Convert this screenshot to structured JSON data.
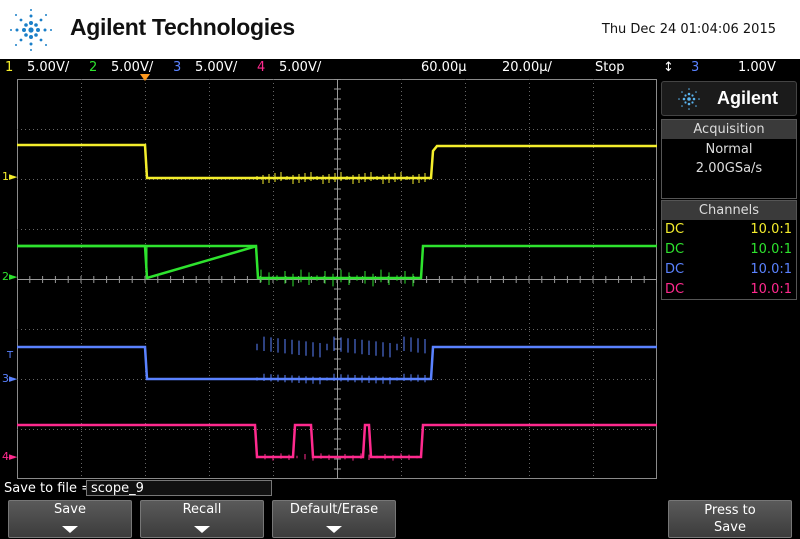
{
  "header": {
    "brand": "Agilent Technologies",
    "datetime": "Thu Dec 24 01:04:06 2015"
  },
  "status_bar": {
    "channels": [
      {
        "num": "1",
        "scale": "5.00V/",
        "color": "#f4ee2c"
      },
      {
        "num": "2",
        "scale": "5.00V/",
        "color": "#2ee32e"
      },
      {
        "num": "3",
        "scale": "5.00V/",
        "color": "#5a82ff"
      },
      {
        "num": "4",
        "scale": "5.00V/",
        "color": "#ff2a8e"
      }
    ],
    "h_delay": "60.00µ",
    "h_scale": "20.00µ/",
    "run_state": "Stop",
    "trigger_symbol": "↕",
    "trigger_source": "3",
    "trigger_level": "1.00V"
  },
  "right_panel": {
    "logo": "Agilent",
    "acquisition": {
      "title": "Acquisition",
      "mode": "Normal",
      "rate": "2.00GSa/s"
    },
    "channels": {
      "title": "Channels",
      "rows": [
        {
          "coupling": "DC",
          "probe": "10.0:1",
          "color": "#f4ee2c"
        },
        {
          "coupling": "DC",
          "probe": "10.0:1",
          "color": "#2ee32e"
        },
        {
          "coupling": "DC",
          "probe": "10.0:1",
          "color": "#5a82ff"
        },
        {
          "coupling": "DC",
          "probe": "10.0:1",
          "color": "#ff2a8e"
        }
      ]
    }
  },
  "grid_markers": {
    "ch1": "1",
    "ch2": "2",
    "ch3": "3",
    "ch4": "4",
    "trigger": "T"
  },
  "save": {
    "label": "Save to file =",
    "filename": "scope_9"
  },
  "softkeys": [
    {
      "label": "Save",
      "line2": ""
    },
    {
      "label": "Recall",
      "line2": ""
    },
    {
      "label": "Default/Erase",
      "line2": ""
    },
    {
      "label": "Press to",
      "line2": "Save"
    }
  ]
}
